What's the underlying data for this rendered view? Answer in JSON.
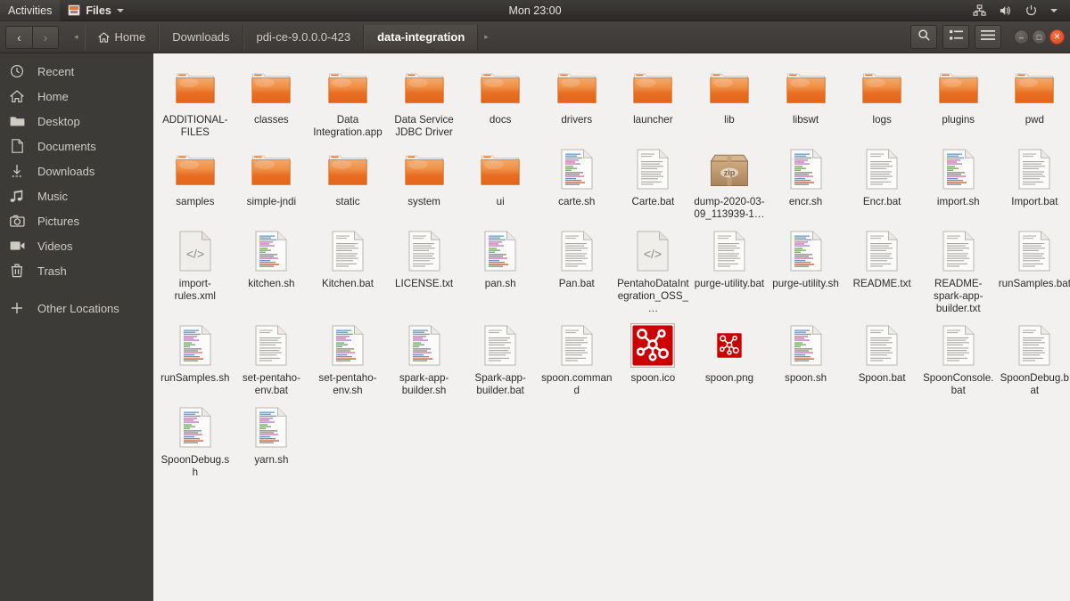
{
  "topbar": {
    "activities": "Activities",
    "app_name": "Files",
    "clock": "Mon 23:00",
    "icons": {
      "files": "files-app-icon",
      "caret": "chevron-down-icon",
      "network": "network-icon",
      "volume": "volume-icon",
      "power": "power-icon",
      "menu_caret": "chevron-down-icon"
    }
  },
  "headerbar": {
    "back_glyph": "‹",
    "forward_glyph": "›",
    "crumb_prev_glyph": "◂",
    "crumb_next_glyph": "▸",
    "breadcrumbs": [
      {
        "label": "Home",
        "icon": "home-icon",
        "current": false
      },
      {
        "label": "Downloads",
        "icon": "",
        "current": false
      },
      {
        "label": "pdi-ce-9.0.0.0-423",
        "icon": "",
        "current": false
      },
      {
        "label": "data-integration",
        "icon": "",
        "current": true
      }
    ],
    "buttons": [
      {
        "name": "search-button",
        "icon": "search-icon"
      },
      {
        "name": "view-options-button",
        "icon": "list-view-icon"
      },
      {
        "name": "app-menu-button",
        "icon": "hamburger-icon"
      }
    ],
    "window_controls": [
      {
        "name": "minimize-button",
        "glyph": "–"
      },
      {
        "name": "maximize-button",
        "glyph": "□"
      },
      {
        "name": "close-button",
        "glyph": "✕"
      }
    ]
  },
  "sidebar": {
    "items": [
      {
        "label": "Recent",
        "icon": "clock-icon"
      },
      {
        "label": "Home",
        "icon": "home-icon"
      },
      {
        "label": "Desktop",
        "icon": "folder-icon"
      },
      {
        "label": "Documents",
        "icon": "document-icon"
      },
      {
        "label": "Downloads",
        "icon": "download-icon"
      },
      {
        "label": "Music",
        "icon": "music-icon"
      },
      {
        "label": "Pictures",
        "icon": "camera-icon"
      },
      {
        "label": "Videos",
        "icon": "video-icon"
      },
      {
        "label": "Trash",
        "icon": "trash-icon"
      }
    ],
    "other": {
      "label": "Other Locations",
      "icon": "plus-icon"
    }
  },
  "colors": {
    "folder_orange": "#e8762d",
    "spoon_red": "#cc0000",
    "accent_close": "#d9411e",
    "sidebar_bg": "#3c3b37",
    "pane_bg": "#f2f1f0",
    "zip_tan": "#b9936a"
  },
  "files": [
    {
      "name": "ADDITIONAL-FILES",
      "type": "folder",
      "icon": "folder-icon",
      "selected": false
    },
    {
      "name": "classes",
      "type": "folder",
      "icon": "folder-icon",
      "selected": false
    },
    {
      "name": "Data Integration.app",
      "type": "folder",
      "icon": "folder-icon",
      "selected": false
    },
    {
      "name": "Data Service JDBC Driver",
      "type": "folder",
      "icon": "folder-icon",
      "selected": false
    },
    {
      "name": "docs",
      "type": "folder",
      "icon": "folder-icon",
      "selected": false
    },
    {
      "name": "drivers",
      "type": "folder",
      "icon": "folder-icon",
      "selected": false
    },
    {
      "name": "launcher",
      "type": "folder",
      "icon": "folder-icon",
      "selected": false
    },
    {
      "name": "lib",
      "type": "folder",
      "icon": "folder-icon",
      "selected": false
    },
    {
      "name": "libswt",
      "type": "folder",
      "icon": "folder-icon",
      "selected": false
    },
    {
      "name": "logs",
      "type": "folder",
      "icon": "folder-icon",
      "selected": false
    },
    {
      "name": "plugins",
      "type": "folder",
      "icon": "folder-icon",
      "selected": false
    },
    {
      "name": "pwd",
      "type": "folder",
      "icon": "folder-icon",
      "selected": false
    },
    {
      "name": "samples",
      "type": "folder",
      "icon": "folder-icon",
      "selected": false
    },
    {
      "name": "simple-jndi",
      "type": "folder",
      "icon": "folder-icon",
      "selected": false
    },
    {
      "name": "static",
      "type": "folder",
      "icon": "folder-icon",
      "selected": false
    },
    {
      "name": "system",
      "type": "folder",
      "icon": "folder-icon",
      "selected": false
    },
    {
      "name": "ui",
      "type": "folder",
      "icon": "folder-icon",
      "selected": false
    },
    {
      "name": "carte.sh",
      "type": "script",
      "icon": "shell-script-icon",
      "selected": false
    },
    {
      "name": "Carte.bat",
      "type": "text",
      "icon": "text-document-icon",
      "selected": false
    },
    {
      "name": "dump-2020-03-09_113939-1…",
      "type": "archive",
      "icon": "zip-archive-icon",
      "selected": false
    },
    {
      "name": "encr.sh",
      "type": "script",
      "icon": "shell-script-icon",
      "selected": false
    },
    {
      "name": "Encr.bat",
      "type": "text",
      "icon": "text-document-icon",
      "selected": false
    },
    {
      "name": "import.sh",
      "type": "script",
      "icon": "shell-script-icon",
      "selected": false
    },
    {
      "name": "Import.bat",
      "type": "text",
      "icon": "text-document-icon",
      "selected": false
    },
    {
      "name": "import-rules.xml",
      "type": "xml",
      "icon": "xml-document-icon",
      "selected": false
    },
    {
      "name": "kitchen.sh",
      "type": "script",
      "icon": "shell-script-icon",
      "selected": false
    },
    {
      "name": "Kitchen.bat",
      "type": "text",
      "icon": "text-document-icon",
      "selected": false
    },
    {
      "name": "LICENSE.txt",
      "type": "text",
      "icon": "text-document-icon",
      "selected": false
    },
    {
      "name": "pan.sh",
      "type": "script",
      "icon": "shell-script-icon",
      "selected": false
    },
    {
      "name": "Pan.bat",
      "type": "text",
      "icon": "text-document-icon",
      "selected": false
    },
    {
      "name": "PentahoDataIntegration_OSS_…",
      "type": "xml",
      "icon": "xml-document-icon",
      "selected": false
    },
    {
      "name": "purge-utility.bat",
      "type": "text",
      "icon": "text-document-icon",
      "selected": false
    },
    {
      "name": "purge-utility.sh",
      "type": "script",
      "icon": "shell-script-icon",
      "selected": false
    },
    {
      "name": "README.txt",
      "type": "text",
      "icon": "text-document-icon",
      "selected": false
    },
    {
      "name": "README-spark-app-builder.txt",
      "type": "text",
      "icon": "text-document-icon",
      "selected": false
    },
    {
      "name": "runSamples.bat",
      "type": "text",
      "icon": "text-document-icon",
      "selected": false
    },
    {
      "name": "runSamples.sh",
      "type": "script",
      "icon": "shell-script-icon",
      "selected": false
    },
    {
      "name": "set-pentaho-env.bat",
      "type": "text",
      "icon": "text-document-icon",
      "selected": false
    },
    {
      "name": "set-pentaho-env.sh",
      "type": "script",
      "icon": "shell-script-icon",
      "selected": false
    },
    {
      "name": "spark-app-builder.sh",
      "type": "script",
      "icon": "shell-script-icon",
      "selected": false
    },
    {
      "name": "Spark-app-builder.bat",
      "type": "text",
      "icon": "text-document-icon",
      "selected": false
    },
    {
      "name": "spoon.command",
      "type": "text",
      "icon": "text-document-icon",
      "selected": false
    },
    {
      "name": "spoon.ico",
      "type": "image",
      "icon": "spoon-logo-icon",
      "selected": true
    },
    {
      "name": "spoon.png",
      "type": "image",
      "icon": "spoon-logo-icon",
      "selected": false
    },
    {
      "name": "spoon.sh",
      "type": "script",
      "icon": "shell-script-icon",
      "selected": false
    },
    {
      "name": "Spoon.bat",
      "type": "text",
      "icon": "text-document-icon",
      "selected": false
    },
    {
      "name": "SpoonConsole.bat",
      "type": "text",
      "icon": "text-document-icon",
      "selected": false
    },
    {
      "name": "SpoonDebug.bat",
      "type": "text",
      "icon": "text-document-icon",
      "selected": false
    },
    {
      "name": "SpoonDebug.sh",
      "type": "script",
      "icon": "shell-script-icon",
      "selected": false
    },
    {
      "name": "yarn.sh",
      "type": "script",
      "icon": "shell-script-icon",
      "selected": false
    }
  ]
}
